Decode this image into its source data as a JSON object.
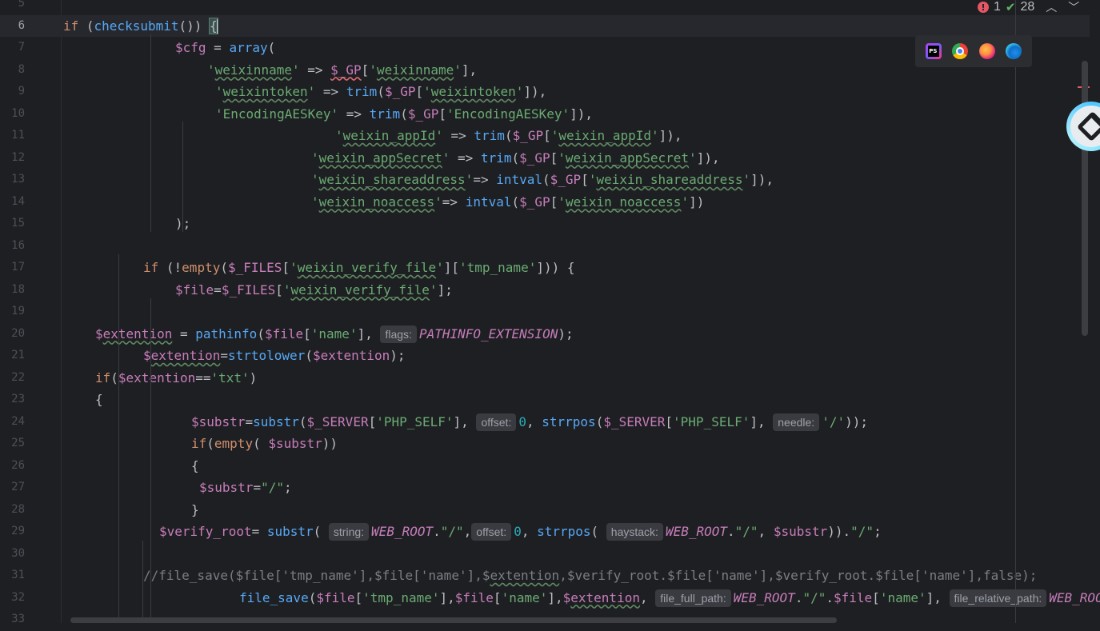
{
  "editor": {
    "current_line": 6,
    "lines": [
      {
        "n": "5",
        "indent": 0,
        "tokens": []
      },
      {
        "n": "6",
        "indent": 0,
        "current": true,
        "tokens": [
          {
            "k": "kw",
            "t": "if"
          },
          {
            "k": "default",
            "t": " ("
          },
          {
            "k": "fn",
            "t": "checksubmit"
          },
          {
            "k": "default",
            "t": "()) "
          },
          {
            "k": "brace",
            "t": "{"
          },
          {
            "k": "caret",
            "t": ""
          }
        ]
      },
      {
        "n": "7",
        "indent": 14,
        "tokens": [
          {
            "k": "var",
            "t": "$cfg"
          },
          {
            "k": "default",
            "t": " = "
          },
          {
            "k": "fn",
            "t": "array"
          },
          {
            "k": "default",
            "t": "("
          }
        ]
      },
      {
        "n": "8",
        "indent": 18,
        "tokens": [
          {
            "k": "str",
            "t": "'"
          },
          {
            "k": "str",
            "t": "weixinname",
            "u": "typo"
          },
          {
            "k": "str",
            "t": "'"
          },
          {
            "k": "default",
            "t": " => "
          },
          {
            "k": "var",
            "t": "$_GP",
            "u": "err"
          },
          {
            "k": "default",
            "t": "["
          },
          {
            "k": "str",
            "t": "'"
          },
          {
            "k": "str",
            "t": "weixinname",
            "u": "typo"
          },
          {
            "k": "str",
            "t": "'"
          },
          {
            "k": "default",
            "t": "],"
          }
        ]
      },
      {
        "n": "9",
        "indent": 19,
        "tokens": [
          {
            "k": "str",
            "t": "'"
          },
          {
            "k": "str",
            "t": "weixintoken",
            "u": "typo"
          },
          {
            "k": "str",
            "t": "'"
          },
          {
            "k": "default",
            "t": " => "
          },
          {
            "k": "fn",
            "t": "trim"
          },
          {
            "k": "default",
            "t": "("
          },
          {
            "k": "var",
            "t": "$_GP"
          },
          {
            "k": "default",
            "t": "["
          },
          {
            "k": "str",
            "t": "'"
          },
          {
            "k": "str",
            "t": "weixintoken",
            "u": "typo"
          },
          {
            "k": "str",
            "t": "'"
          },
          {
            "k": "default",
            "t": "]),"
          }
        ]
      },
      {
        "n": "10",
        "indent": 19,
        "tokens": [
          {
            "k": "str",
            "t": "'EncodingAESKey'"
          },
          {
            "k": "default",
            "t": " => "
          },
          {
            "k": "fn",
            "t": "trim"
          },
          {
            "k": "default",
            "t": "("
          },
          {
            "k": "var",
            "t": "$_GP"
          },
          {
            "k": "default",
            "t": "["
          },
          {
            "k": "str",
            "t": "'EncodingAESKey'"
          },
          {
            "k": "default",
            "t": "]),"
          }
        ]
      },
      {
        "n": "11",
        "indent": 34,
        "tokens": [
          {
            "k": "str",
            "t": "'"
          },
          {
            "k": "str",
            "t": "weixin_appId",
            "u": "typo"
          },
          {
            "k": "str",
            "t": "'"
          },
          {
            "k": "default",
            "t": " => "
          },
          {
            "k": "fn",
            "t": "trim"
          },
          {
            "k": "default",
            "t": "("
          },
          {
            "k": "var",
            "t": "$_GP"
          },
          {
            "k": "default",
            "t": "["
          },
          {
            "k": "str",
            "t": "'"
          },
          {
            "k": "str",
            "t": "weixin_appId",
            "u": "typo"
          },
          {
            "k": "str",
            "t": "'"
          },
          {
            "k": "default",
            "t": "]),"
          }
        ]
      },
      {
        "n": "12",
        "indent": 31,
        "tokens": [
          {
            "k": "str",
            "t": "'"
          },
          {
            "k": "str",
            "t": "weixin_appSecret",
            "u": "typo"
          },
          {
            "k": "str",
            "t": "'"
          },
          {
            "k": "default",
            "t": " => "
          },
          {
            "k": "fn",
            "t": "trim"
          },
          {
            "k": "default",
            "t": "("
          },
          {
            "k": "var",
            "t": "$_GP"
          },
          {
            "k": "default",
            "t": "["
          },
          {
            "k": "str",
            "t": "'"
          },
          {
            "k": "str",
            "t": "weixin_appSecret",
            "u": "typo"
          },
          {
            "k": "str",
            "t": "'"
          },
          {
            "k": "default",
            "t": "]),"
          }
        ]
      },
      {
        "n": "13",
        "indent": 31,
        "tokens": [
          {
            "k": "str",
            "t": "'"
          },
          {
            "k": "str",
            "t": "weixin_shareaddress",
            "u": "typo"
          },
          {
            "k": "str",
            "t": "'"
          },
          {
            "k": "default",
            "t": "=> "
          },
          {
            "k": "fn",
            "t": "intval"
          },
          {
            "k": "default",
            "t": "("
          },
          {
            "k": "var",
            "t": "$_GP"
          },
          {
            "k": "default",
            "t": "["
          },
          {
            "k": "str",
            "t": "'"
          },
          {
            "k": "str",
            "t": "weixin_shareaddress",
            "u": "typo"
          },
          {
            "k": "str",
            "t": "'"
          },
          {
            "k": "default",
            "t": "]),"
          }
        ]
      },
      {
        "n": "14",
        "indent": 31,
        "tokens": [
          {
            "k": "str",
            "t": "'"
          },
          {
            "k": "str",
            "t": "weixin_noaccess",
            "u": "typo"
          },
          {
            "k": "str",
            "t": "'"
          },
          {
            "k": "default",
            "t": "=> "
          },
          {
            "k": "fn",
            "t": "intval"
          },
          {
            "k": "default",
            "t": "("
          },
          {
            "k": "var",
            "t": "$_GP"
          },
          {
            "k": "default",
            "t": "["
          },
          {
            "k": "str",
            "t": "'"
          },
          {
            "k": "str",
            "t": "weixin_noaccess",
            "u": "typo"
          },
          {
            "k": "str",
            "t": "'"
          },
          {
            "k": "default",
            "t": "])"
          }
        ]
      },
      {
        "n": "15",
        "indent": 14,
        "tokens": [
          {
            "k": "default",
            "t": ");"
          }
        ]
      },
      {
        "n": "16",
        "indent": 0,
        "tokens": []
      },
      {
        "n": "17",
        "indent": 10,
        "tokens": [
          {
            "k": "kw",
            "t": "if"
          },
          {
            "k": "default",
            "t": " (!"
          },
          {
            "k": "kw",
            "t": "empty"
          },
          {
            "k": "default",
            "t": "("
          },
          {
            "k": "var",
            "t": "$_FILES"
          },
          {
            "k": "default",
            "t": "["
          },
          {
            "k": "str",
            "t": "'"
          },
          {
            "k": "str",
            "t": "weixin_verify_file",
            "u": "typo"
          },
          {
            "k": "str",
            "t": "'"
          },
          {
            "k": "default",
            "t": "]["
          },
          {
            "k": "str",
            "t": "'tmp_name'"
          },
          {
            "k": "default",
            "t": "])) {"
          }
        ]
      },
      {
        "n": "18",
        "indent": 14,
        "tokens": [
          {
            "k": "var",
            "t": "$file"
          },
          {
            "k": "default",
            "t": "="
          },
          {
            "k": "var",
            "t": "$_FILES"
          },
          {
            "k": "default",
            "t": "["
          },
          {
            "k": "str",
            "t": "'"
          },
          {
            "k": "str",
            "t": "weixin_verify_file",
            "u": "typo"
          },
          {
            "k": "str",
            "t": "'"
          },
          {
            "k": "default",
            "t": "];"
          }
        ]
      },
      {
        "n": "19",
        "indent": 0,
        "tokens": []
      },
      {
        "n": "20",
        "indent": 4,
        "tokens": [
          {
            "k": "var",
            "t": "$"
          },
          {
            "k": "var",
            "t": "extention",
            "u": "typo"
          },
          {
            "k": "default",
            "t": " = "
          },
          {
            "k": "fn",
            "t": "pathinfo"
          },
          {
            "k": "default",
            "t": "("
          },
          {
            "k": "var",
            "t": "$file"
          },
          {
            "k": "default",
            "t": "["
          },
          {
            "k": "str",
            "t": "'name'"
          },
          {
            "k": "default",
            "t": "], "
          },
          {
            "k": "hint",
            "t": "flags:"
          },
          {
            "k": "const",
            "t": "PATHINFO_EXTENSION"
          },
          {
            "k": "default",
            "t": ");"
          }
        ]
      },
      {
        "n": "21",
        "indent": 10,
        "tokens": [
          {
            "k": "var",
            "t": "$"
          },
          {
            "k": "var",
            "t": "extention",
            "u": "typo"
          },
          {
            "k": "default",
            "t": "="
          },
          {
            "k": "fn",
            "t": "strtolower"
          },
          {
            "k": "default",
            "t": "("
          },
          {
            "k": "var",
            "t": "$extention"
          },
          {
            "k": "default",
            "t": ");"
          }
        ]
      },
      {
        "n": "22",
        "indent": 4,
        "tokens": [
          {
            "k": "kw",
            "t": "if"
          },
          {
            "k": "default",
            "t": "("
          },
          {
            "k": "var",
            "t": "$extention"
          },
          {
            "k": "default",
            "t": "=="
          },
          {
            "k": "str",
            "t": "'txt'"
          },
          {
            "k": "default",
            "t": ")"
          }
        ]
      },
      {
        "n": "23",
        "indent": 4,
        "tokens": [
          {
            "k": "default",
            "t": "{"
          }
        ]
      },
      {
        "n": "24",
        "indent": 16,
        "tokens": [
          {
            "k": "var",
            "t": "$substr"
          },
          {
            "k": "default",
            "t": "="
          },
          {
            "k": "fn",
            "t": "substr"
          },
          {
            "k": "default",
            "t": "("
          },
          {
            "k": "var",
            "t": "$_SERVER"
          },
          {
            "k": "default",
            "t": "["
          },
          {
            "k": "str",
            "t": "'PHP_SELF'"
          },
          {
            "k": "default",
            "t": "], "
          },
          {
            "k": "hint",
            "t": "offset:"
          },
          {
            "k": "num",
            "t": "0"
          },
          {
            "k": "default",
            "t": ", "
          },
          {
            "k": "fn",
            "t": "strrpos"
          },
          {
            "k": "default",
            "t": "("
          },
          {
            "k": "var",
            "t": "$_SERVER"
          },
          {
            "k": "default",
            "t": "["
          },
          {
            "k": "str",
            "t": "'PHP_SELF'"
          },
          {
            "k": "default",
            "t": "], "
          },
          {
            "k": "hint",
            "t": "needle:"
          },
          {
            "k": "str",
            "t": "'/'"
          },
          {
            "k": "default",
            "t": "));"
          }
        ]
      },
      {
        "n": "25",
        "indent": 16,
        "tokens": [
          {
            "k": "kw",
            "t": "if"
          },
          {
            "k": "default",
            "t": "("
          },
          {
            "k": "kw",
            "t": "empty"
          },
          {
            "k": "default",
            "t": "( "
          },
          {
            "k": "var",
            "t": "$substr"
          },
          {
            "k": "default",
            "t": "))"
          }
        ]
      },
      {
        "n": "26",
        "indent": 16,
        "tokens": [
          {
            "k": "default",
            "t": "{"
          }
        ]
      },
      {
        "n": "27",
        "indent": 17,
        "tokens": [
          {
            "k": "var",
            "t": "$substr"
          },
          {
            "k": "default",
            "t": "="
          },
          {
            "k": "str",
            "t": "\"/\""
          },
          {
            "k": "default",
            "t": ";"
          }
        ]
      },
      {
        "n": "28",
        "indent": 16,
        "tokens": [
          {
            "k": "default",
            "t": "}"
          }
        ]
      },
      {
        "n": "29",
        "indent": 12,
        "tokens": [
          {
            "k": "var",
            "t": "$verify_root"
          },
          {
            "k": "default",
            "t": "= "
          },
          {
            "k": "fn",
            "t": "substr"
          },
          {
            "k": "default",
            "t": "( "
          },
          {
            "k": "hint",
            "t": "string:"
          },
          {
            "k": "const",
            "t": "WEB_ROOT"
          },
          {
            "k": "default",
            "t": "."
          },
          {
            "k": "str",
            "t": "\"/\""
          },
          {
            "k": "default",
            "t": ","
          },
          {
            "k": "hint",
            "t": "offset:"
          },
          {
            "k": "num",
            "t": "0"
          },
          {
            "k": "default",
            "t": ", "
          },
          {
            "k": "fn",
            "t": "strrpos"
          },
          {
            "k": "default",
            "t": "( "
          },
          {
            "k": "hint",
            "t": "haystack:"
          },
          {
            "k": "const",
            "t": "WEB_ROOT"
          },
          {
            "k": "default",
            "t": "."
          },
          {
            "k": "str",
            "t": "\"/\""
          },
          {
            "k": "default",
            "t": ", "
          },
          {
            "k": "var",
            "t": "$substr"
          },
          {
            "k": "default",
            "t": "))."
          },
          {
            "k": "str",
            "t": "\"/\""
          },
          {
            "k": "default",
            "t": ";"
          }
        ]
      },
      {
        "n": "30",
        "indent": 0,
        "tokens": []
      },
      {
        "n": "31",
        "indent": 10,
        "tokens": [
          {
            "k": "cmt",
            "t": "//file_save($file['tmp_name'],$file['name'],$"
          },
          {
            "k": "cmt",
            "t": "extention",
            "u": "typo"
          },
          {
            "k": "cmt",
            "t": ",$verify_root.$file['name'],$verify_root.$file['name'],false);"
          }
        ]
      },
      {
        "n": "32",
        "indent": 22,
        "tokens": [
          {
            "k": "fn",
            "t": "file_save"
          },
          {
            "k": "default",
            "t": "("
          },
          {
            "k": "var",
            "t": "$file"
          },
          {
            "k": "default",
            "t": "["
          },
          {
            "k": "str",
            "t": "'tmp_name'"
          },
          {
            "k": "default",
            "t": "],"
          },
          {
            "k": "var",
            "t": "$file"
          },
          {
            "k": "default",
            "t": "["
          },
          {
            "k": "str",
            "t": "'name'"
          },
          {
            "k": "default",
            "t": "],"
          },
          {
            "k": "var",
            "t": "$"
          },
          {
            "k": "var",
            "t": "extention",
            "u": "typo"
          },
          {
            "k": "default",
            "t": ", "
          },
          {
            "k": "hint",
            "t": "file_full_path:"
          },
          {
            "k": "const",
            "t": "WEB_ROOT"
          },
          {
            "k": "default",
            "t": "."
          },
          {
            "k": "str",
            "t": "\"/\""
          },
          {
            "k": "default",
            "t": "."
          },
          {
            "k": "var",
            "t": "$file"
          },
          {
            "k": "default",
            "t": "["
          },
          {
            "k": "str",
            "t": "'name'"
          },
          {
            "k": "default",
            "t": "], "
          },
          {
            "k": "hint",
            "t": "file_relative_path:"
          },
          {
            "k": "const",
            "t": "WEB_ROOT"
          }
        ]
      },
      {
        "n": "33",
        "indent": 0,
        "tokens": []
      }
    ]
  },
  "status": {
    "errors": "1",
    "checks": "28",
    "error_icon": "error-icon",
    "check_icon": "check-icon",
    "prev_icon": "chevron-up-icon",
    "next_icon": "chevron-down-icon"
  },
  "browsers": [
    {
      "name": "phpstorm-icon"
    },
    {
      "name": "chrome-icon"
    },
    {
      "name": "firefox-icon"
    },
    {
      "name": "edge-icon"
    }
  ],
  "colors": {
    "background": "#1e1f22",
    "keyword": "#cf8e6d",
    "function": "#56a8f5",
    "variable": "#c77dbb",
    "string": "#6aab73",
    "number": "#2aacb8",
    "comment": "#7a7e85"
  }
}
